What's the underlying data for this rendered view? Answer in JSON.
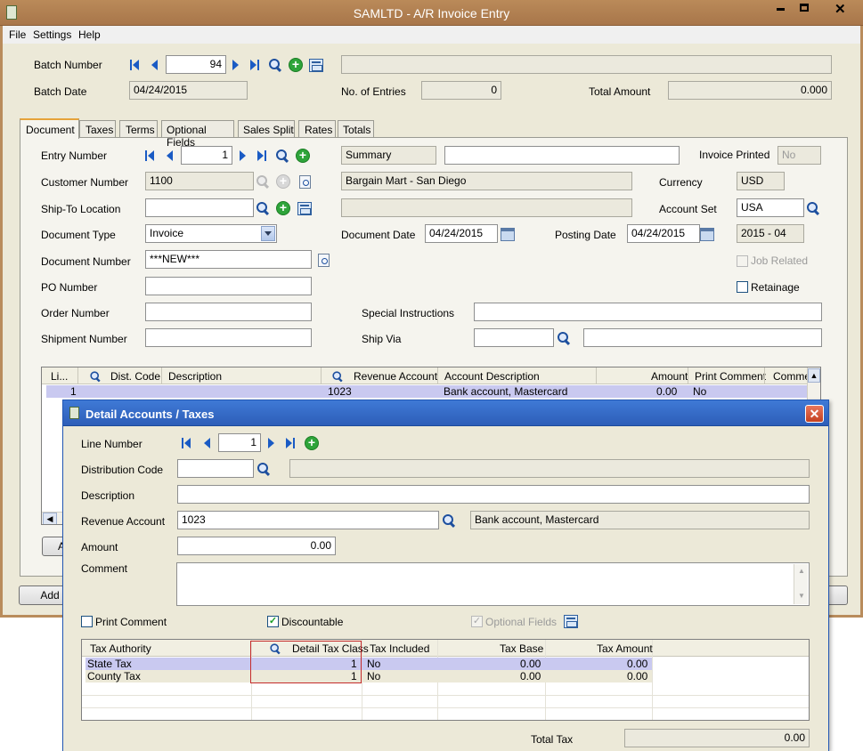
{
  "window": {
    "title": "SAMLTD - A/R Invoice Entry",
    "min": "▬",
    "max": "□",
    "close": "✕"
  },
  "menu": [
    "File",
    "Settings",
    "Help"
  ],
  "batch": {
    "label": "Batch Number",
    "value": "94",
    "desc": "",
    "date_label": "Batch Date",
    "date": "04/24/2015",
    "entries_label": "No. of Entries",
    "entries": "0",
    "total_label": "Total Amount",
    "total": "0.000"
  },
  "tabs": [
    "Document",
    "Taxes",
    "Terms",
    "Optional Fields",
    "Sales Split",
    "Rates",
    "Totals"
  ],
  "doc": {
    "entry_label": "Entry Number",
    "entry": "1",
    "summary": "Summary",
    "summary_desc": "",
    "printed_label": "Invoice Printed",
    "printed": "No",
    "customer_label": "Customer Number",
    "customer": "1100",
    "customer_name": "Bargain Mart - San Diego",
    "currency_label": "Currency",
    "currency": "USD",
    "shipto_label": "Ship-To Location",
    "shipto": "",
    "shipto_desc": "",
    "acctset_label": "Account Set",
    "acctset": "USA",
    "doctype_label": "Document Type",
    "doctype": "Invoice",
    "docdate_label": "Document Date",
    "docdate": "04/24/2015",
    "postdate_label": "Posting Date",
    "postdate": "04/24/2015",
    "period": "2015 - 04",
    "docnum_label": "Document Number",
    "docnum": "***NEW***",
    "jobrel_label": "Job Related",
    "po_label": "PO Number",
    "po": "",
    "retainage_label": "Retainage",
    "order_label": "Order Number",
    "order": "",
    "special_label": "Special Instructions",
    "special": "",
    "shipment_label": "Shipment Number",
    "shipment": "",
    "shipvia_label": "Ship Via",
    "shipvia": "",
    "shipvia_desc": ""
  },
  "grid": {
    "columns": [
      "Li...",
      "Dist. Code",
      "Description",
      "Revenue Account",
      "Account Description",
      "Amount",
      "Print Comment",
      "Commer"
    ],
    "rows": [
      [
        "1",
        "",
        "",
        "1023",
        "Bank account, Mastercard",
        "0.00",
        "No",
        ""
      ]
    ]
  },
  "bottom_buttons": {
    "add": "Add",
    "a": "A"
  },
  "dialog": {
    "title": "Detail Accounts / Taxes",
    "line_label": "Line Number",
    "line": "1",
    "dist_label": "Distribution Code",
    "dist": "",
    "dist_desc": "",
    "desc_label": "Description",
    "desc": "",
    "rev_label": "Revenue Account",
    "rev": "1023",
    "rev_desc": "Bank account, Mastercard",
    "amount_label": "Amount",
    "amount": "0.00",
    "comment_label": "Comment",
    "comment": "",
    "print_comment_label": "Print Comment",
    "discountable_label": "Discountable",
    "optional_fields_label": "Optional Fields",
    "tax_columns": [
      "Tax Authority",
      "Detail Tax Class",
      "Tax Included",
      "Tax Base",
      "Tax Amount"
    ],
    "tax_rows": [
      [
        "State Tax",
        "1",
        "No",
        "0.00",
        "0.00"
      ],
      [
        "County Tax",
        "1",
        "No",
        "0.00",
        "0.00"
      ]
    ],
    "total_tax_label": "Total Tax",
    "total_tax": "0.00"
  }
}
